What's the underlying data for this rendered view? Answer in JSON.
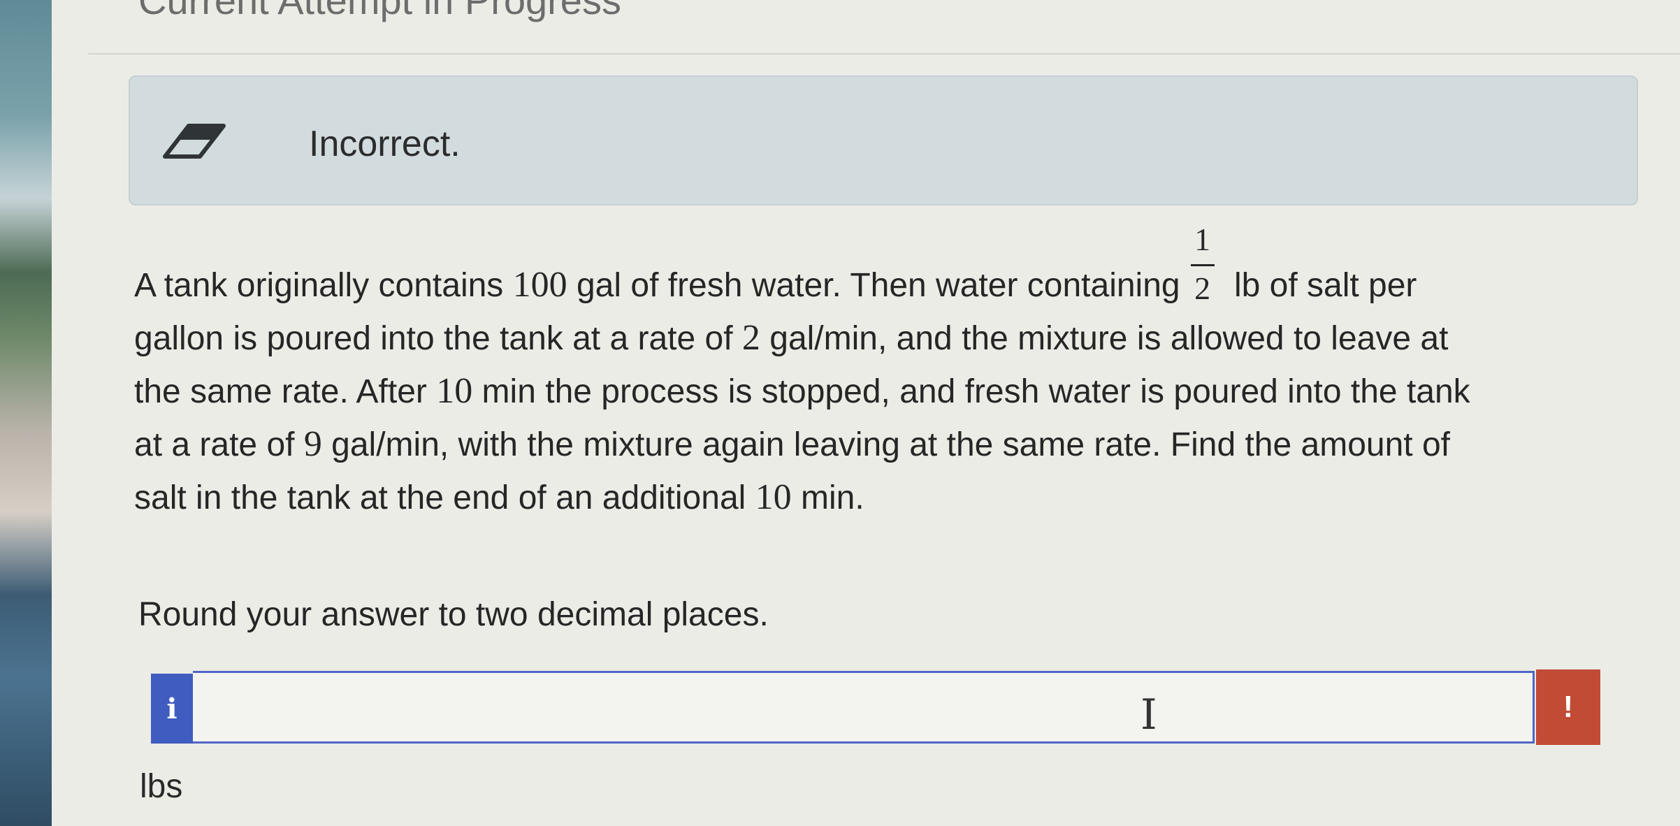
{
  "header": {
    "title": "Current Attempt in Progress"
  },
  "feedback": {
    "icon": "eraser-icon",
    "text": "Incorrect."
  },
  "question": {
    "line1_a": "A tank originally contains ",
    "line1_num": "100",
    "line1_b": " gal of fresh water. Then water containing",
    "fraction": {
      "numerator": "1",
      "denominator": "2"
    },
    "line1_c": " lb of salt per",
    "line2_a": "gallon is poured into the tank at a rate of ",
    "line2_num": "2",
    "line2_b": " gal/min, and the mixture is allowed to leave at",
    "line3_a": "the same rate. After ",
    "line3_num": "10",
    "line3_b": " min the process is stopped, and fresh water is poured into the tank",
    "line4_a": "at a rate of ",
    "line4_num": "9",
    "line4_b": " gal/min, with the mixture again leaving at the same rate. Find the amount of",
    "line5_a": "salt in the tank at the end of an additional ",
    "line5_num": "10",
    "line5_b": " min."
  },
  "instruction": "Round your answer to two decimal places.",
  "answer": {
    "info_label": "i",
    "value": "",
    "cursor_icon": "text-cursor-icon",
    "cursor_glyph": "I",
    "alert_label": "!",
    "unit": "lbs"
  },
  "colors": {
    "info_button": "#3f5cc1",
    "alert_button": "#c14b35",
    "feedback_bg": "#d2dcdf",
    "input_border": "#4f66c6"
  }
}
